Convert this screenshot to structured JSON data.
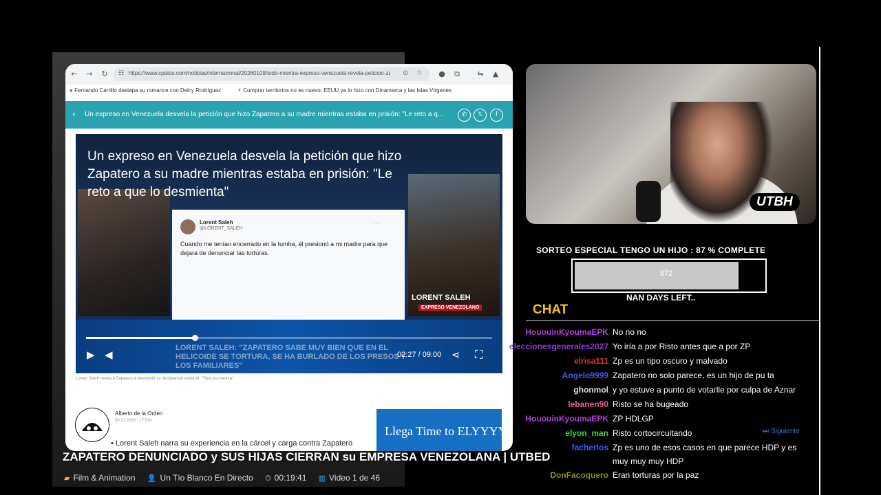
{
  "browser": {
    "url": "https://www.cpatos.com/noticias/internacional/20260109/todo-mientra-expreso-venezuela-revela-peticion-zapatero-madre-estaba-prision",
    "bookmarks": [
      "Fernando Carrillo destapa su romance con Delcy Rodríguez",
      "Comprar territorios no es nuevo: EEUU ya lo hizo con Dinamarca y las Islas Vírgenes"
    ],
    "article_bar_title": "Un expreso en Venezuela desvela la petición que hizo Zapatero a su madre mientras estaba en prisión: \"Le reto a q...",
    "share_icons": [
      "whatsapp-icon",
      "x-icon",
      "facebook-icon"
    ]
  },
  "video": {
    "title": "Un expreso en Venezuela desvela la petición que hizo Zapatero a su madre mientras estaba en prisión: \"Le reto a que lo desmienta\"",
    "tweet_name": "Lorent Saleh",
    "tweet_handle": "@LORENT_SALEH",
    "tweet_text": "Cuando me tenían encerrado en la tumba, él presionó a mi madre para que dejara de denunciar las torturas.",
    "guest_label": "LORENT SALEH",
    "guest_sub": "EXPRESO VENEZOLANO",
    "ticker": "LORENT SALEH: \"ZAPATERO SABE MUY BIEN QUE EN EL HELICOIDE SE TORTURA, SE HA BURLADO DE LOS PRESOS Y LOS FAMILIARES\"",
    "time": "02:27 / 09:00",
    "progress": 0.27
  },
  "article": {
    "caption": "Lorent Saleh revela a Zapatero a desmentir su declaración sobre él. \"Todo es mentira\"",
    "author_name": "Alberto de la Orden",
    "author_date": "09.01.2026 - 17:51h",
    "bullet": "Lorent Saleh narra su experiencia en la cárcel y carga contra Zapatero",
    "ad_text": "Llega Time to ELYYYY!"
  },
  "footer": {
    "headline": "ZAPATERO DENUNCIADO y SUS HIJAS CIERRAN su EMPRESA VENEZOLANA | UTBED",
    "category": "Film & Animation",
    "channel": "Un Tío Blanco En Directo",
    "duration": "00:19:41",
    "playlist": "Video 1 de 46"
  },
  "stream": {
    "cam_logo": "UTBH",
    "giveaway": "SORTEO ESPECIAL TENGO UN HIJO :  87 % COMPLETE",
    "giveaway_value": "872",
    "giveaway_progress": 0.87,
    "days_left": "NAN DAYS LEFT..",
    "chat_title": "CHAT",
    "siguiente": "Siguiente",
    "chat": [
      {
        "user": "HououinKyoumaEPK",
        "msg": "No no no",
        "color": "#b040e0"
      },
      {
        "user": "eleccionesgenerales2027",
        "msg": "Yo iría a por Risto antes que a por ZP",
        "color": "#8a3fd1"
      },
      {
        "user": "elrisa111",
        "msg": "Zp es un tipo oscuro y malvado",
        "color": "#e03030"
      },
      {
        "user": "Angelo9999",
        "msg": "Zapatero no solo parece, es un hijo de pu ta",
        "color": "#3b5ef0"
      },
      {
        "user": "ghonmol",
        "msg": "y yo estuve a punto de votarlle por culpa de Aznar",
        "color": "#e0e0e0"
      },
      {
        "user": "lebanen90",
        "msg": "Risto se ha bugeado",
        "color": "#e55fa0"
      },
      {
        "user": "HououinKyoumaEPK",
        "msg": "ZP HDLGP",
        "color": "#b040e0"
      },
      {
        "user": "elyon_man",
        "msg": "Risto cortocircuitando",
        "color": "#3bd14a"
      },
      {
        "user": "facherlos",
        "msg": "Zp es uno de esos casos en que parece HDP y es",
        "msg2": "muy muy muy HDP",
        "color": "#3b5ef0"
      },
      {
        "user": "DonFacoquero",
        "msg": "Eran torturas por la paz",
        "color": "#8a8a2a"
      }
    ]
  }
}
